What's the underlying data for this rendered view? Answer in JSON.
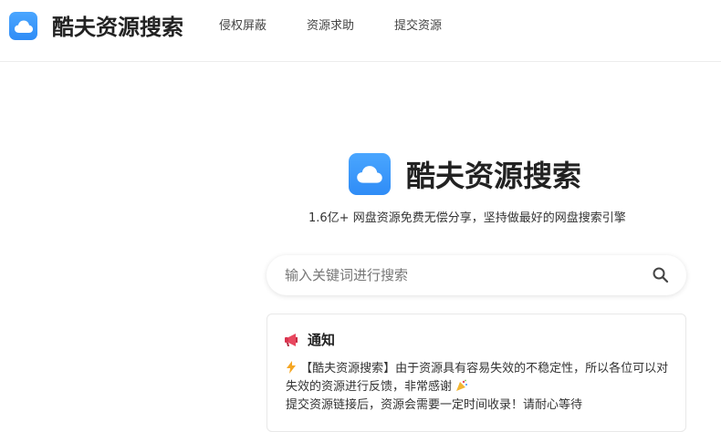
{
  "header": {
    "site_name": "酷夫资源搜索",
    "nav": [
      {
        "label": "侵权屏蔽"
      },
      {
        "label": "资源求助"
      },
      {
        "label": "提交资源"
      }
    ]
  },
  "hero": {
    "title": "酷夫资源搜索",
    "tagline": "1.6亿+ 网盘资源免费无偿分享，坚持做最好的网盘搜索引擎"
  },
  "search": {
    "placeholder": "输入关键词进行搜索",
    "value": ""
  },
  "notice": {
    "title": "通知",
    "line1": "【酷夫资源搜索】由于资源具有容易失效的不稳定性，所以各位可以对失效的资源进行反馈，非常感谢",
    "line2": "提交资源链接后，资源会需要一定时间收录！请耐心等待"
  },
  "icons": {
    "logo": "cloud-icon",
    "search": "search-icon",
    "notice": "megaphone-icon",
    "bolt": "lightning-icon",
    "party": "party-popper-icon"
  },
  "colors": {
    "brand": "#3596f8"
  }
}
